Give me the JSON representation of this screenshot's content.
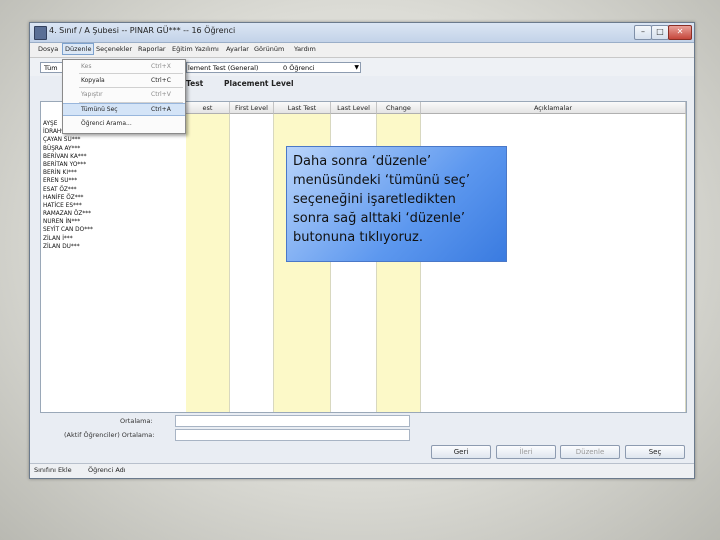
{
  "window": {
    "title": "4. Sınıf / A Şubesi -- PINAR GÜ*** -- 16 Öğrenci",
    "controls": {
      "minimize": "–",
      "maximize": "□",
      "close": "✕"
    }
  },
  "menubar": {
    "items": [
      "Dosya",
      "Düzenle",
      "Seçenekler",
      "Raporlar",
      "Eğitim Yazılımı",
      "Ayarlar",
      "Görünüm",
      "Yardım"
    ]
  },
  "toolbar": {
    "combo_left": "Tüm",
    "combo_test": "lement Test (General)",
    "combo_count": "0 Öğrenci"
  },
  "tabs": [
    "Test",
    "Placement Level"
  ],
  "dropdown": {
    "items": [
      {
        "label": "Kes",
        "shortcut": "Ctrl+X",
        "disabled": true
      },
      {
        "label": "Kopyala",
        "shortcut": "Ctrl+C",
        "disabled": false
      },
      {
        "label": "Yapıştır",
        "shortcut": "Ctrl+V",
        "disabled": true
      },
      {
        "label": "Tümünü Seç",
        "shortcut": "Ctrl+A",
        "disabled": false
      },
      {
        "label": "Öğrenci Arama...",
        "shortcut": "",
        "disabled": false
      }
    ]
  },
  "grid": {
    "columns": [
      "est",
      "First Level",
      "Last Test",
      "Last Level",
      "Change",
      "Açıklamalar"
    ],
    "students": [
      "AYŞE",
      "İDRAH***",
      "ÇAYAN SU***",
      "BÜŞRA AY***",
      "BERİVAN KA***",
      "BERİTAN YO***",
      "BERİN KI***",
      "EREN SU***",
      "ESAT ÖZ***",
      "HANİFE ÖZ***",
      "HATİCE ES***",
      "RAMAZAN ÖZ***",
      "NUREN İN***",
      "SEYİT CAN DO***",
      "ZİLAN İ***",
      "ZİLAN DU***"
    ]
  },
  "footer": {
    "average_label": "Ortalama:",
    "active_average_label": "(Aktif Öğrenciler) Ortalama:"
  },
  "buttons": {
    "back": "Geri",
    "next": "İleri",
    "edit": "Düzenle",
    "select": "Seç"
  },
  "statusbar": {
    "class_text": "Sınıfını Ekle",
    "student_text": "Öğrenci Adı"
  },
  "callout": {
    "lines": [
      "Daha sonra ‘düzenle’",
      "menüsündeki ‘tümünü seç’",
      "seçeneğini işaretledikten",
      "sonra sağ alttaki ‘düzenle’",
      "butonuna tıklıyoruz."
    ]
  }
}
